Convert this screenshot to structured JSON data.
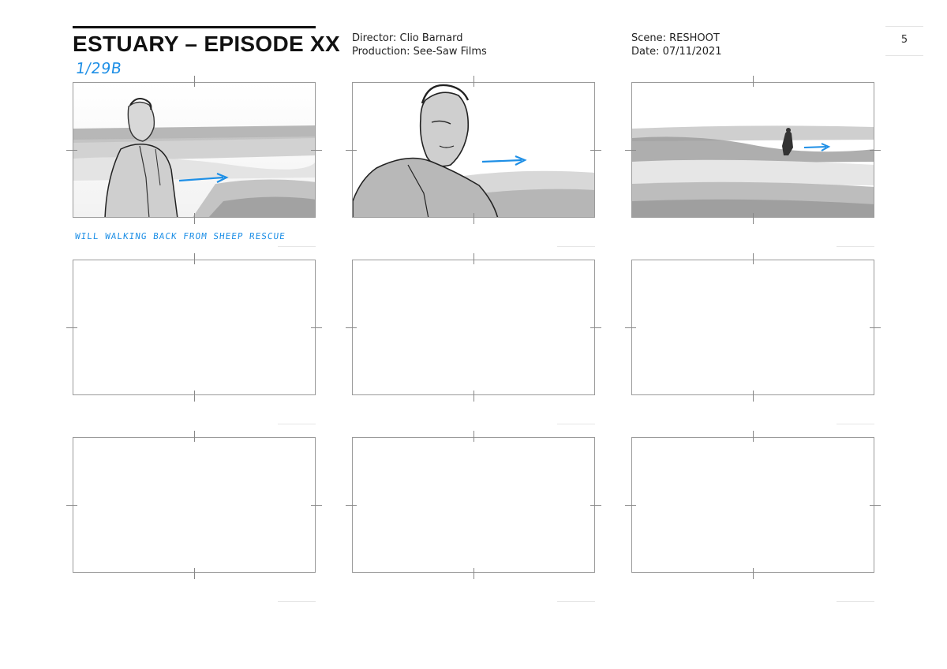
{
  "header": {
    "title": "ESTUARY – EPISODE XX",
    "shot_number": "1/29B",
    "director": "Director: Clio Barnard",
    "production": "Production: See-Saw Films",
    "scene": "Scene: RESHOOT",
    "date": "Date: 07/11/2021",
    "page_number": "5"
  },
  "panels": [
    {
      "id": "panel-1",
      "content": "man-closeup-left",
      "caption": "WILL WALKING BACK FROM SHEEP RESCUE"
    },
    {
      "id": "panel-2",
      "content": "man-face-closeup"
    },
    {
      "id": "panel-3",
      "content": "figure-walking-distance"
    },
    {
      "id": "panel-4",
      "content": "empty"
    },
    {
      "id": "panel-5",
      "content": "empty"
    },
    {
      "id": "panel-6",
      "content": "empty"
    },
    {
      "id": "panel-7",
      "content": "empty"
    },
    {
      "id": "panel-8",
      "content": "empty"
    },
    {
      "id": "panel-9",
      "content": "empty"
    }
  ],
  "colors": {
    "annotation_blue": "#1e8fe6",
    "frame_gray": "#9a9a9a"
  }
}
